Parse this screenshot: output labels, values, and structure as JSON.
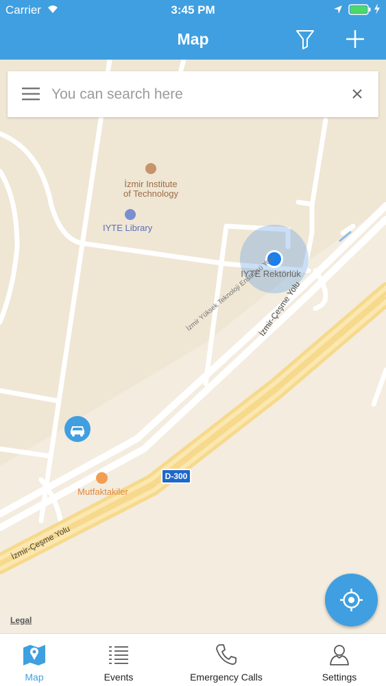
{
  "status_bar": {
    "carrier": "Carrier",
    "time": "3:45 PM"
  },
  "header": {
    "title": "Map"
  },
  "search": {
    "placeholder": "You can search here"
  },
  "map": {
    "pois": {
      "institute_line1": "İzmir Institute",
      "institute_line2": "of Technology",
      "library": "IYTE Library",
      "rektorluk": "IYTE Rektörlük",
      "restaurant": "Mutfaktakiler"
    },
    "roads": {
      "enstitusu": "İzmir Yüksek Teknoloji Enstitüsü Yolu",
      "cesme_upper": "İzmir-Çeşme Yolu",
      "cesme_lower": "İzmir-Çeşme Yolu",
      "highway_shield": "D-300"
    },
    "legal": "Legal"
  },
  "tabbar": {
    "active_color": "#3f9fe0",
    "items": [
      {
        "label": "Map",
        "icon": "map-icon",
        "active": true
      },
      {
        "label": "Events",
        "icon": "list-icon",
        "active": false
      },
      {
        "label": "Emergency Calls",
        "icon": "phone-icon",
        "active": false
      },
      {
        "label": "Settings",
        "icon": "user-icon",
        "active": false
      }
    ]
  }
}
